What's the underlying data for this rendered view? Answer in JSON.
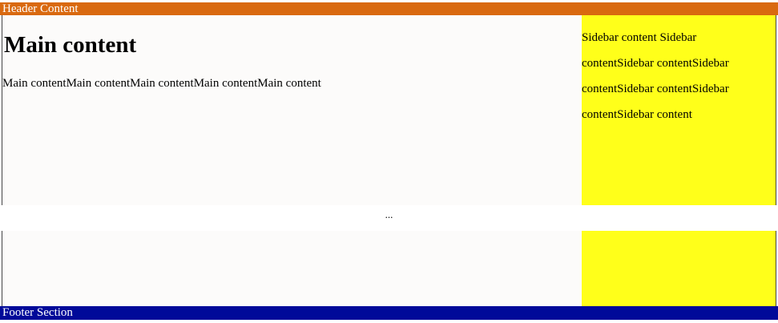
{
  "header": {
    "text": "Header Content"
  },
  "main": {
    "title": "Main content",
    "body": "Main contentMain contentMain contentMain contentMain content"
  },
  "sidebar": {
    "text": "Sidebar content Sidebar contentSidebar contentSidebar contentSidebar contentSidebar contentSidebar content"
  },
  "gap": {
    "ellipsis": "..."
  },
  "footer": {
    "text": "Footer Section"
  },
  "colors": {
    "header_bg": "#d9690f",
    "main_bg": "#fcfbfa",
    "sidebar_bg": "#ffff1a",
    "footer_bg": "#000a99"
  }
}
